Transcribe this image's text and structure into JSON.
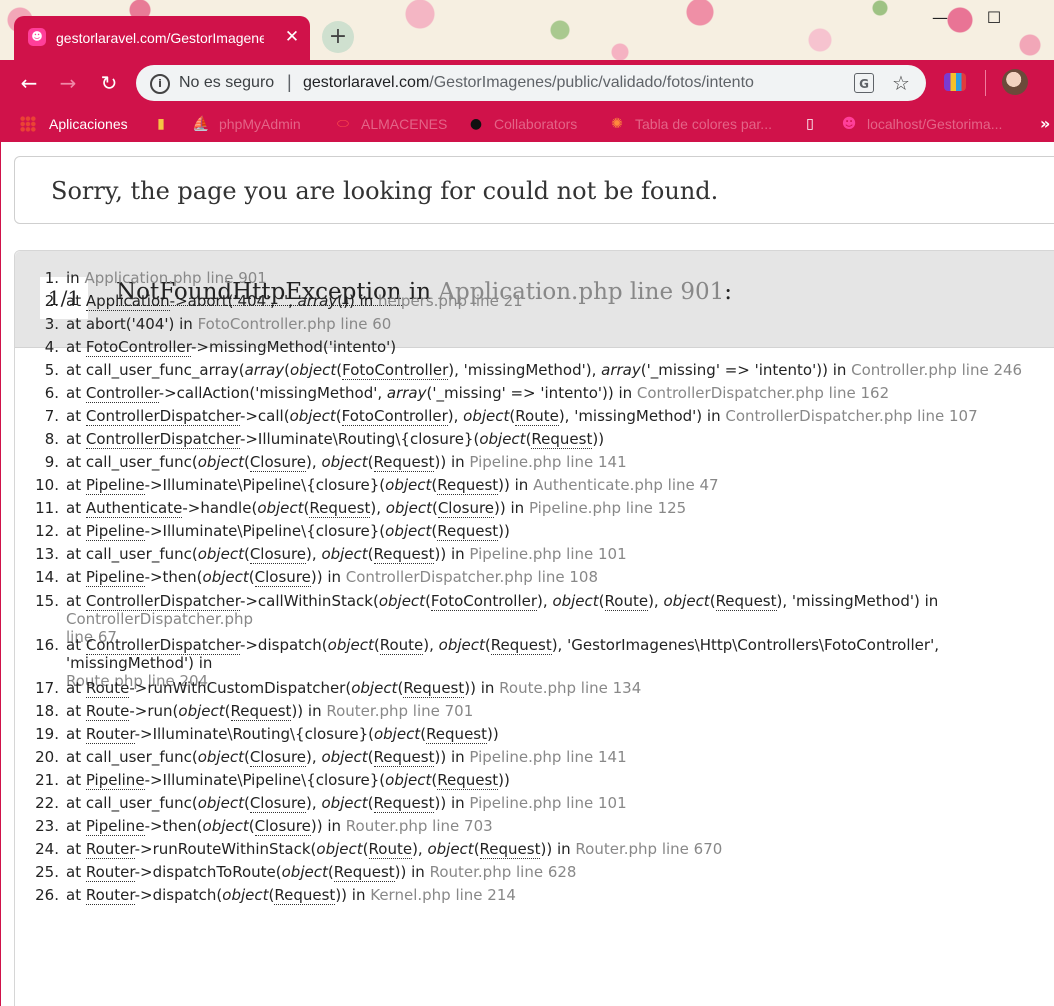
{
  "browser": {
    "tab_title": "gestorlaravel.com/GestorImagenes/public/validado/fotos/intento",
    "tab_favicon": "smile-icon",
    "new_tab_label": "+",
    "security_label": "No es seguro",
    "url_host": "gestorlaravel.com",
    "url_path": "/GestorImagenes/public/validado/fotos/intento",
    "accent_color": "#d0124a",
    "bookmarks": [
      {
        "label": "Aplicaciones",
        "icon": "apps-grid-icon"
      },
      {
        "label": "",
        "icon": "folder-icon"
      },
      {
        "label": "phpMyAdmin",
        "icon": "phpmyadmin-icon"
      },
      {
        "label": "ALMACENES",
        "icon": "oracle-icon"
      },
      {
        "label": "Collaborators",
        "icon": "github-icon"
      },
      {
        "label": "Tabla de colores par...",
        "icon": "palette-icon"
      },
      {
        "label": "",
        "icon": "page-icon"
      },
      {
        "label": "localhost/Gestorima...",
        "icon": "smile-icon"
      }
    ],
    "more_bookmarks": "»"
  },
  "page": {
    "message": "Sorry, the page you are looking for could not be found.",
    "counter": "1/1",
    "exception_class": "NotFoundHttpException",
    "exception_in": " in ",
    "exception_location": "Application.php line 901",
    "exception_colon": ":"
  },
  "trace": [
    {
      "n": "1.",
      "html": "in <span class=\"file\">Application.php line 901</span>"
    },
    {
      "n": "2.",
      "html": "at <span class=\"abbr\">Application</span>->abort('404', '', <em class=\"kw\">array</em>()) in <span class=\"file\">helpers.php line 21</span>"
    },
    {
      "n": "3.",
      "html": "at abort('404') in <span class=\"file\">FotoController.php line 60</span>"
    },
    {
      "n": "4.",
      "html": "at <span class=\"abbr\">FotoController</span>->missingMethod('intento')"
    },
    {
      "n": "5.",
      "html": "at call_user_func_array(<em class=\"kw\">array</em>(<em class=\"kw\">object</em>(<span class=\"abbr\">FotoController</span>), 'missingMethod'), <em class=\"kw\">array</em>('_missing' => 'intento')) in <span class=\"file\">Controller.php line 246</span>"
    },
    {
      "n": "6.",
      "html": "at <span class=\"abbr\">Controller</span>->callAction('missingMethod', <em class=\"kw\">array</em>('_missing' => 'intento')) in <span class=\"file\">ControllerDispatcher.php line 162</span>"
    },
    {
      "n": "7.",
      "html": "at <span class=\"abbr\">ControllerDispatcher</span>->call(<em class=\"kw\">object</em>(<span class=\"abbr\">FotoController</span>), <em class=\"kw\">object</em>(<span class=\"abbr\">Route</span>), 'missingMethod') in <span class=\"file\">ControllerDispatcher.php line 107</span>"
    },
    {
      "n": "8.",
      "html": "at <span class=\"abbr\">ControllerDispatcher</span>->Illuminate\\Routing\\{closure}(<em class=\"kw\">object</em>(<span class=\"abbr\">Request</span>))"
    },
    {
      "n": "9.",
      "html": "at call_user_func(<em class=\"kw\">object</em>(<span class=\"abbr\">Closure</span>), <em class=\"kw\">object</em>(<span class=\"abbr\">Request</span>)) in <span class=\"file\">Pipeline.php line 141</span>"
    },
    {
      "n": "10.",
      "html": "at <span class=\"abbr\">Pipeline</span>->Illuminate\\Pipeline\\{closure}(<em class=\"kw\">object</em>(<span class=\"abbr\">Request</span>)) in <span class=\"file\">Authenticate.php line 47</span>"
    },
    {
      "n": "11.",
      "html": "at <span class=\"abbr\">Authenticate</span>->handle(<em class=\"kw\">object</em>(<span class=\"abbr\">Request</span>), <em class=\"kw\">object</em>(<span class=\"abbr\">Closure</span>)) in <span class=\"file\">Pipeline.php line 125</span>"
    },
    {
      "n": "12.",
      "html": "at <span class=\"abbr\">Pipeline</span>->Illuminate\\Pipeline\\{closure}(<em class=\"kw\">object</em>(<span class=\"abbr\">Request</span>))"
    },
    {
      "n": "13.",
      "html": "at call_user_func(<em class=\"kw\">object</em>(<span class=\"abbr\">Closure</span>), <em class=\"kw\">object</em>(<span class=\"abbr\">Request</span>)) in <span class=\"file\">Pipeline.php line 101</span>"
    },
    {
      "n": "14.",
      "html": "at <span class=\"abbr\">Pipeline</span>->then(<em class=\"kw\">object</em>(<span class=\"abbr\">Closure</span>)) in <span class=\"file\">ControllerDispatcher.php line 108</span>"
    },
    {
      "n": "15.",
      "wrap": true,
      "html": "at <span class=\"abbr\">ControllerDispatcher</span>->callWithinStack(<em class=\"kw\">object</em>(<span class=\"abbr\">FotoController</span>), <em class=\"kw\">object</em>(<span class=\"abbr\">Route</span>), <em class=\"kw\">object</em>(<span class=\"abbr\">Request</span>), 'missingMethod') in <span class=\"file\">ControllerDispatcher.php<br>line 67</span>"
    },
    {
      "n": "16.",
      "wrap": true,
      "html": "at <span class=\"abbr\">ControllerDispatcher</span>->dispatch(<em class=\"kw\">object</em>(<span class=\"abbr\">Route</span>), <em class=\"kw\">object</em>(<span class=\"abbr\">Request</span>), 'GestorImagenes\\Http\\Controllers\\FotoController', 'missingMethod') in<br><span class=\"file\">Route.php line 204</span>"
    },
    {
      "n": "17.",
      "html": "at <span class=\"abbr\">Route</span>->runWithCustomDispatcher(<em class=\"kw\">object</em>(<span class=\"abbr\">Request</span>)) in <span class=\"file\">Route.php line 134</span>"
    },
    {
      "n": "18.",
      "html": "at <span class=\"abbr\">Route</span>->run(<em class=\"kw\">object</em>(<span class=\"abbr\">Request</span>)) in <span class=\"file\">Router.php line 701</span>"
    },
    {
      "n": "19.",
      "html": "at <span class=\"abbr\">Router</span>->Illuminate\\Routing\\{closure}(<em class=\"kw\">object</em>(<span class=\"abbr\">Request</span>))"
    },
    {
      "n": "20.",
      "html": "at call_user_func(<em class=\"kw\">object</em>(<span class=\"abbr\">Closure</span>), <em class=\"kw\">object</em>(<span class=\"abbr\">Request</span>)) in <span class=\"file\">Pipeline.php line 141</span>"
    },
    {
      "n": "21.",
      "html": "at <span class=\"abbr\">Pipeline</span>->Illuminate\\Pipeline\\{closure}(<em class=\"kw\">object</em>(<span class=\"abbr\">Request</span>))"
    },
    {
      "n": "22.",
      "html": "at call_user_func(<em class=\"kw\">object</em>(<span class=\"abbr\">Closure</span>), <em class=\"kw\">object</em>(<span class=\"abbr\">Request</span>)) in <span class=\"file\">Pipeline.php line 101</span>"
    },
    {
      "n": "23.",
      "html": "at <span class=\"abbr\">Pipeline</span>->then(<em class=\"kw\">object</em>(<span class=\"abbr\">Closure</span>)) in <span class=\"file\">Router.php line 703</span>"
    },
    {
      "n": "24.",
      "html": "at <span class=\"abbr\">Router</span>->runRouteWithinStack(<em class=\"kw\">object</em>(<span class=\"abbr\">Route</span>), <em class=\"kw\">object</em>(<span class=\"abbr\">Request</span>)) in <span class=\"file\">Router.php line 670</span>"
    },
    {
      "n": "25.",
      "html": "at <span class=\"abbr\">Router</span>->dispatchToRoute(<em class=\"kw\">object</em>(<span class=\"abbr\">Request</span>)) in <span class=\"file\">Router.php line 628</span>"
    },
    {
      "n": "26.",
      "html": "at <span class=\"abbr\">Router</span>->dispatch(<em class=\"kw\">object</em>(<span class=\"abbr\">Request</span>)) in <span class=\"file\">Kernel.php line 214</span>"
    }
  ]
}
